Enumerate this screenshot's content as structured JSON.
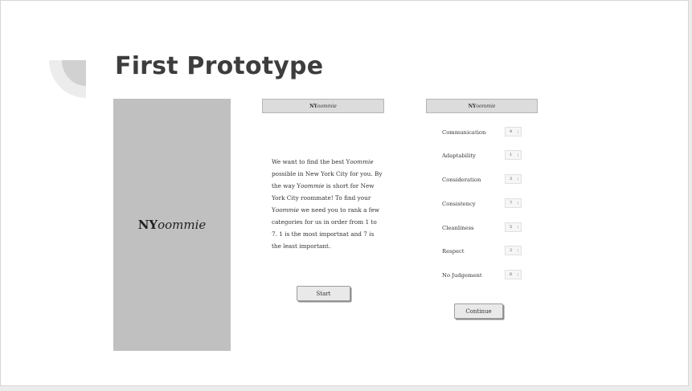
{
  "slide": {
    "title": "First Prototype"
  },
  "splash": {
    "logo_prefix": "NY",
    "logo_suffix": "oommie"
  },
  "intro_screen": {
    "header_prefix": "NY",
    "header_suffix": "oommie",
    "paragraph": [
      {
        "text": "We want to find the best Y",
        "italic": false
      },
      {
        "text": "oommie",
        "italic": true
      },
      {
        "text": " possible in New York City for you.  By the way Y",
        "italic": false
      },
      {
        "text": "oommie",
        "italic": true
      },
      {
        "text": " is short for New York City roommate!  To find your Y",
        "italic": false
      },
      {
        "text": "oommie",
        "italic": true
      },
      {
        "text": " we need  you to rank a few categories for us in order from 1 to 7.   1 is the most importnat and 7 is the least important.",
        "italic": false
      }
    ],
    "start_label": "Start"
  },
  "rank_screen": {
    "header_prefix": "NY",
    "header_suffix": "oommie",
    "categories": [
      {
        "label": "Communication",
        "rank": "4"
      },
      {
        "label": "Adaptability",
        "rank": "1"
      },
      {
        "label": "Consideration",
        "rank": "3"
      },
      {
        "label": "Consistency",
        "rank": "7"
      },
      {
        "label": "Cleanliness",
        "rank": "5"
      },
      {
        "label": "Respect",
        "rank": "2"
      },
      {
        "label": "No Judgement",
        "rank": "6"
      }
    ],
    "continue_label": "Continue"
  },
  "colors": {
    "splash_bg": "#c0c0c0",
    "title": "#3d3d3d",
    "deco_light": "#ececec",
    "deco_dark": "#d1d1d1"
  }
}
